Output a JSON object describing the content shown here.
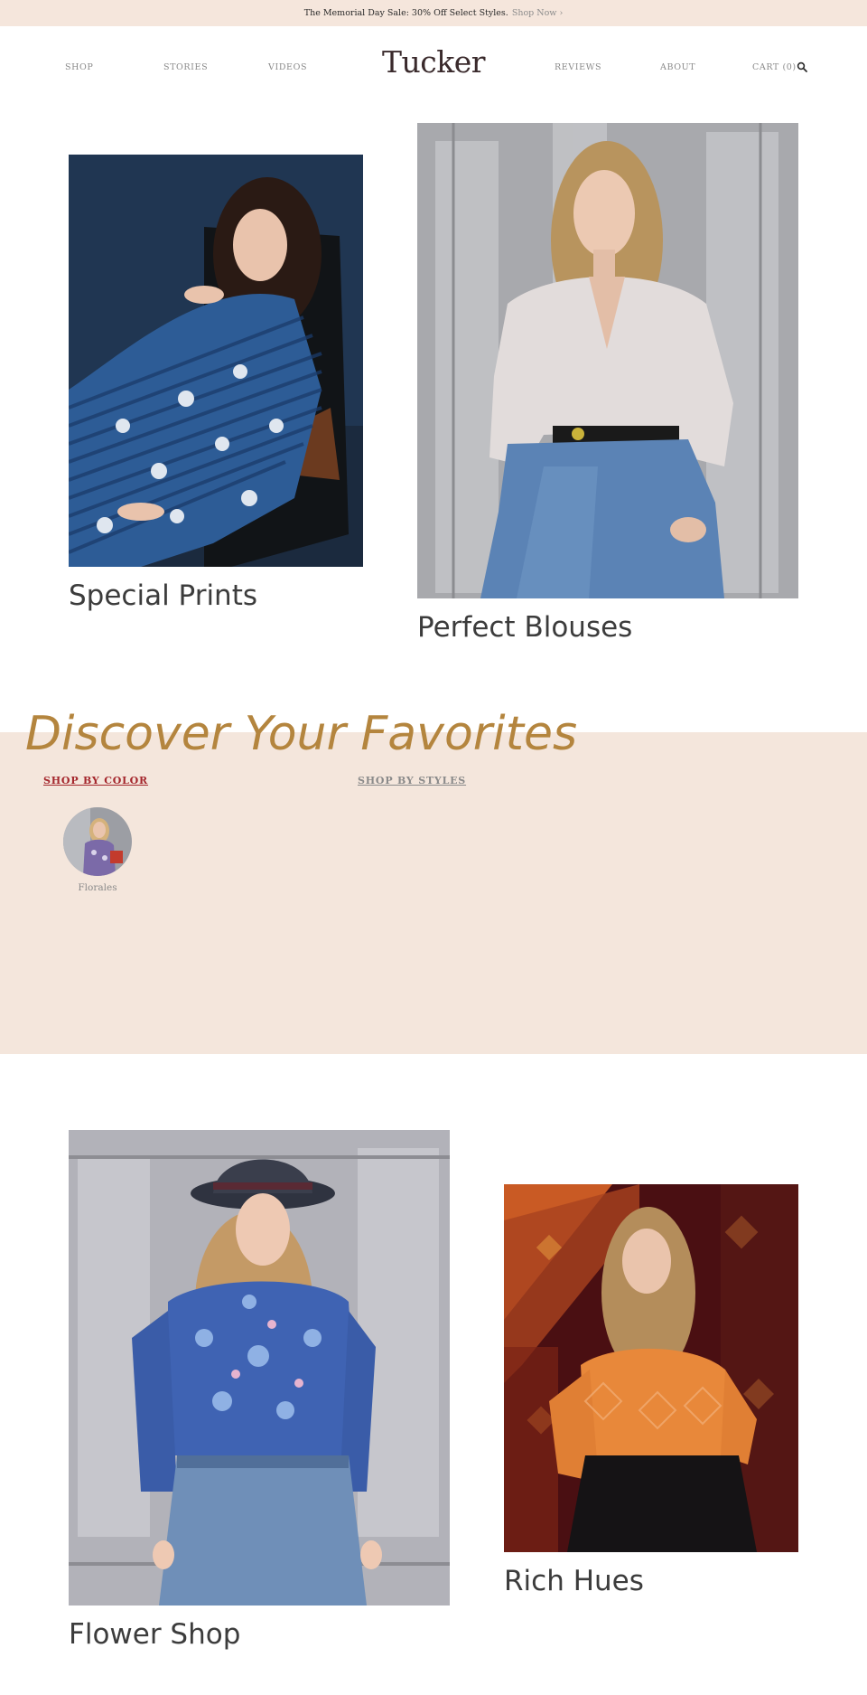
{
  "announcement": {
    "text": "The Memorial Day Sale: 30% Off Select Styles.",
    "link": "Shop Now ›"
  },
  "header": {
    "logo": "Tucker",
    "nav_left": [
      "SHOP",
      "STORIES",
      "VIDEOS"
    ],
    "nav_right": [
      "REVIEWS",
      "ABOUT",
      "CART (0)"
    ],
    "search_icon": "search-icon"
  },
  "features": [
    {
      "title": "Special Prints"
    },
    {
      "title": "Perfect Blouses"
    },
    {
      "title": "Flower Shop"
    },
    {
      "title": "Rich Hues"
    }
  ],
  "discover": {
    "heading": "Discover Your Favorites",
    "tabs": [
      "SHOP BY COLOR",
      "SHOP BY STYLES"
    ],
    "active_tab": 0,
    "swatches": [
      {
        "label": "Florales"
      }
    ]
  },
  "colors": {
    "announce_bg": "#f5e6dc",
    "band_bg": "#f4e6dc",
    "heading": "#b4853e",
    "active_tab": "#a4262c"
  }
}
